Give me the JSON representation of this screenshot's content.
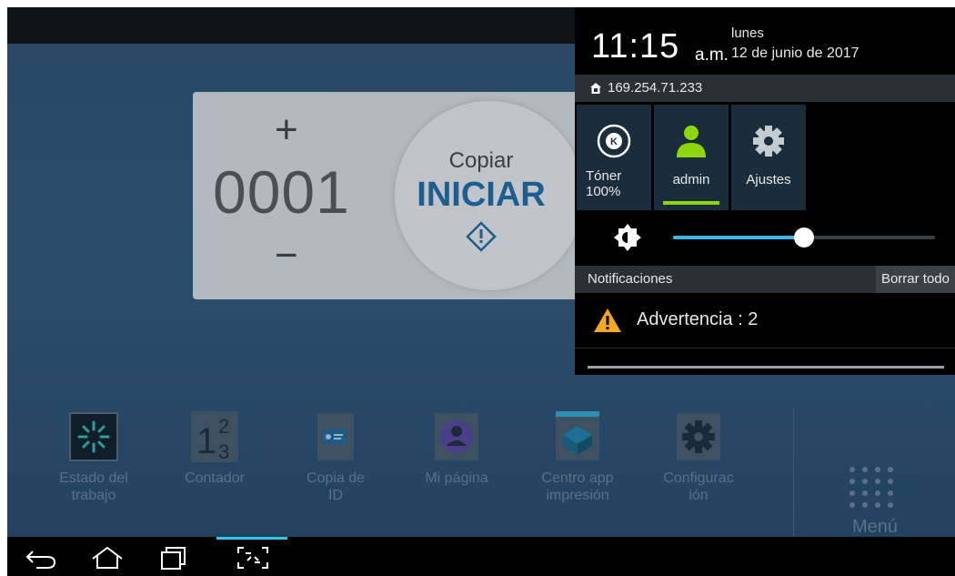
{
  "status": {
    "time": "11:15",
    "ampm": "a.m.",
    "day": "lunes",
    "date": "12 de junio de 2017",
    "ip_address": "169.254.71.233"
  },
  "quick_settings": {
    "toner_label": "Tóner",
    "toner_level": "100%",
    "user_label": "admin",
    "settings_label": "Ajustes",
    "brightness_fraction": 0.5
  },
  "notifications": {
    "title": "Notificaciones",
    "clear_all": "Borrar todo",
    "items": [
      {
        "text": "Advertencia : 2",
        "icon": "warning-icon"
      }
    ]
  },
  "copy_widget": {
    "plus": "+",
    "minus": "−",
    "count": "0001",
    "start_subtitle": "Copiar",
    "start_label": "INICIAR"
  },
  "apps": [
    {
      "line1": "Estado del",
      "line2": "trabajo",
      "icon": "job-status-icon"
    },
    {
      "line1": "Contador",
      "line2": "",
      "icon": "counter-icon"
    },
    {
      "line1": "Copia de",
      "line2": "ID",
      "icon": "id-copy-icon"
    },
    {
      "line1": "Mi página",
      "line2": "",
      "icon": "my-page-icon"
    },
    {
      "line1": "Centro app",
      "line2": "impresión",
      "icon": "app-center-icon"
    },
    {
      "line1": "Configurac",
      "line2": "ión",
      "icon": "settings-icon"
    }
  ],
  "menu": {
    "label": "Menú"
  },
  "colors": {
    "accent_blue": "#46b4e8",
    "user_green": "#8dd60c",
    "warning_orange": "#f5a623",
    "start_blue": "#1c5e8f"
  }
}
